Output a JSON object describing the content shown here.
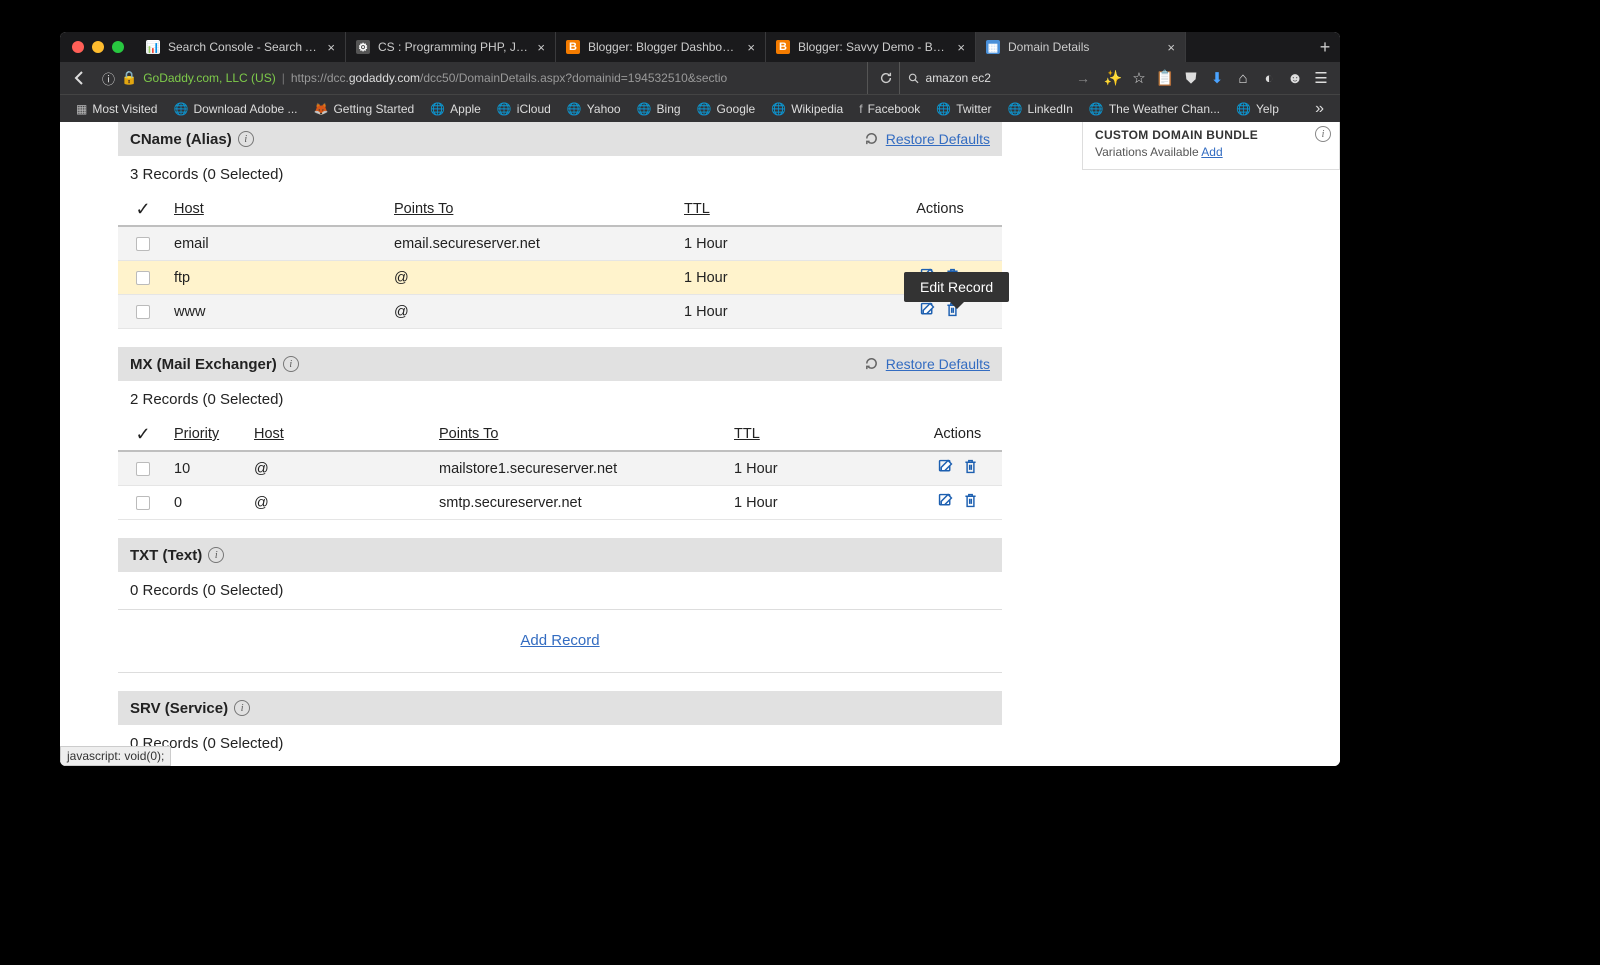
{
  "browser": {
    "tabs": [
      {
        "label": "Search Console - Search A...",
        "favicon_bg": "#fff",
        "favicon_text": "📊"
      },
      {
        "label": "CS : Programming PHP, JQ...",
        "favicon_bg": "#555",
        "favicon_text": "⚙"
      },
      {
        "label": "Blogger: Blogger Dashboard",
        "favicon_bg": "#f57c00",
        "favicon_text": "B"
      },
      {
        "label": "Blogger: Savvy Demo - Bas...",
        "favicon_bg": "#f57c00",
        "favicon_text": "B"
      },
      {
        "label": "Domain Details",
        "favicon_bg": "#4a90d9",
        "favicon_text": "▦",
        "active": true
      }
    ],
    "identity": "GoDaddy.com, LLC (US)",
    "url_prefix": "https://dcc.",
    "url_domain": "godaddy.com",
    "url_path": "/dcc50/DomainDetails.aspx?domainid=194532510&sectio",
    "search_value": "amazon ec2",
    "bookmarks": [
      "Most Visited",
      "Download Adobe ...",
      "Getting Started",
      "Apple",
      "iCloud",
      "Yahoo",
      "Bing",
      "Google",
      "Wikipedia",
      "Facebook",
      "Twitter",
      "LinkedIn",
      "The Weather Chan...",
      "Yelp"
    ]
  },
  "sidecard": {
    "title": "CUSTOM DOMAIN BUNDLE",
    "sub": "Variations Available",
    "link": "Add"
  },
  "sections": {
    "cname": {
      "title": "CName (Alias)",
      "restore": "Restore Defaults",
      "count": "3 Records (0 Selected)",
      "headers": {
        "host": "Host",
        "points": "Points To",
        "ttl": "TTL",
        "actions": "Actions"
      },
      "rows": [
        {
          "host": "email",
          "points": "email.secureserver.net",
          "ttl": "1 Hour"
        },
        {
          "host": "ftp",
          "points": "@",
          "ttl": "1 Hour",
          "hl": true
        },
        {
          "host": "www",
          "points": "@",
          "ttl": "1 Hour"
        }
      ],
      "tooltip": "Edit Record"
    },
    "mx": {
      "title": "MX (Mail Exchanger)",
      "restore": "Restore Defaults",
      "count": "2 Records (0 Selected)",
      "headers": {
        "priority": "Priority",
        "host": "Host",
        "points": "Points To",
        "ttl": "TTL",
        "actions": "Actions"
      },
      "rows": [
        {
          "priority": "10",
          "host": "@",
          "points": "mailstore1.secureserver.net",
          "ttl": "1 Hour"
        },
        {
          "priority": "0",
          "host": "@",
          "points": "smtp.secureserver.net",
          "ttl": "1 Hour"
        }
      ]
    },
    "txt": {
      "title": "TXT (Text)",
      "count": "0 Records (0 Selected)"
    },
    "srv": {
      "title": "SRV (Service)",
      "count": "0 Records (0 Selected)"
    }
  },
  "add_record": "Add Record",
  "status": "javascript: void(0);"
}
